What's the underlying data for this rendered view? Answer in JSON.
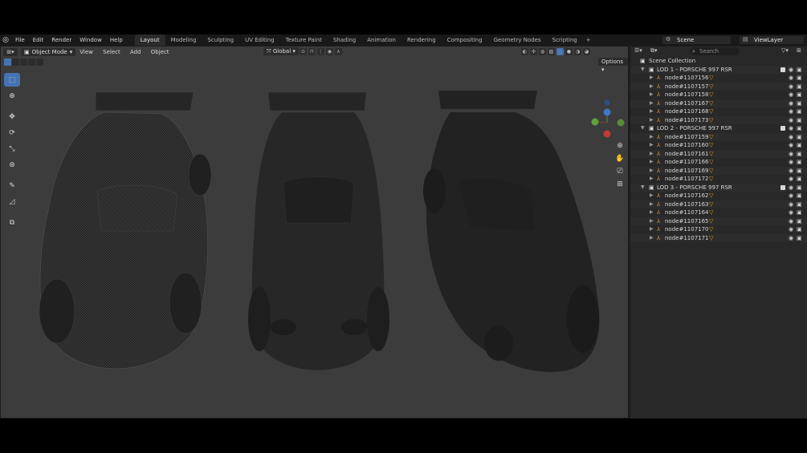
{
  "menubar": {
    "items": [
      "File",
      "Edit",
      "Render",
      "Window",
      "Help"
    ],
    "workspaces": [
      "Layout",
      "Modeling",
      "Sculpting",
      "UV Editing",
      "Texture Paint",
      "Shading",
      "Animation",
      "Rendering",
      "Compositing",
      "Geometry Nodes",
      "Scripting"
    ],
    "active_workspace": "Layout",
    "add_tab": "+",
    "scene": "Scene",
    "view_layer": "ViewLayer"
  },
  "viewport": {
    "mode": "Object Mode",
    "menus": [
      "View",
      "Select",
      "Add",
      "Object"
    ],
    "orientation": "Global",
    "options": "Options"
  },
  "outliner": {
    "search_placeholder": "Search",
    "root": "Scene Collection",
    "collections": [
      {
        "name": "LOD 1 - PORSCHE 997 RSR",
        "nodes": [
          "node#1107156",
          "node#1107157",
          "node#1107158",
          "node#1107167",
          "node#1107168",
          "node#1107173"
        ]
      },
      {
        "name": "LOD 2 - PORSCHE 997 RSR",
        "nodes": [
          "node#1107159",
          "node#1107160",
          "node#1107161",
          "node#1107166",
          "node#1107169",
          "node#1107172"
        ]
      },
      {
        "name": "LOD 3 - PORSCHE 997 RSR",
        "nodes": [
          "node#1107162",
          "node#1107163",
          "node#1107164",
          "node#1107165",
          "node#1107170",
          "node#1107171"
        ]
      }
    ]
  },
  "colors": {
    "accent": "#4772b3",
    "viewport_bg": "#3c3c3c",
    "node_icon": "#e8963a"
  }
}
